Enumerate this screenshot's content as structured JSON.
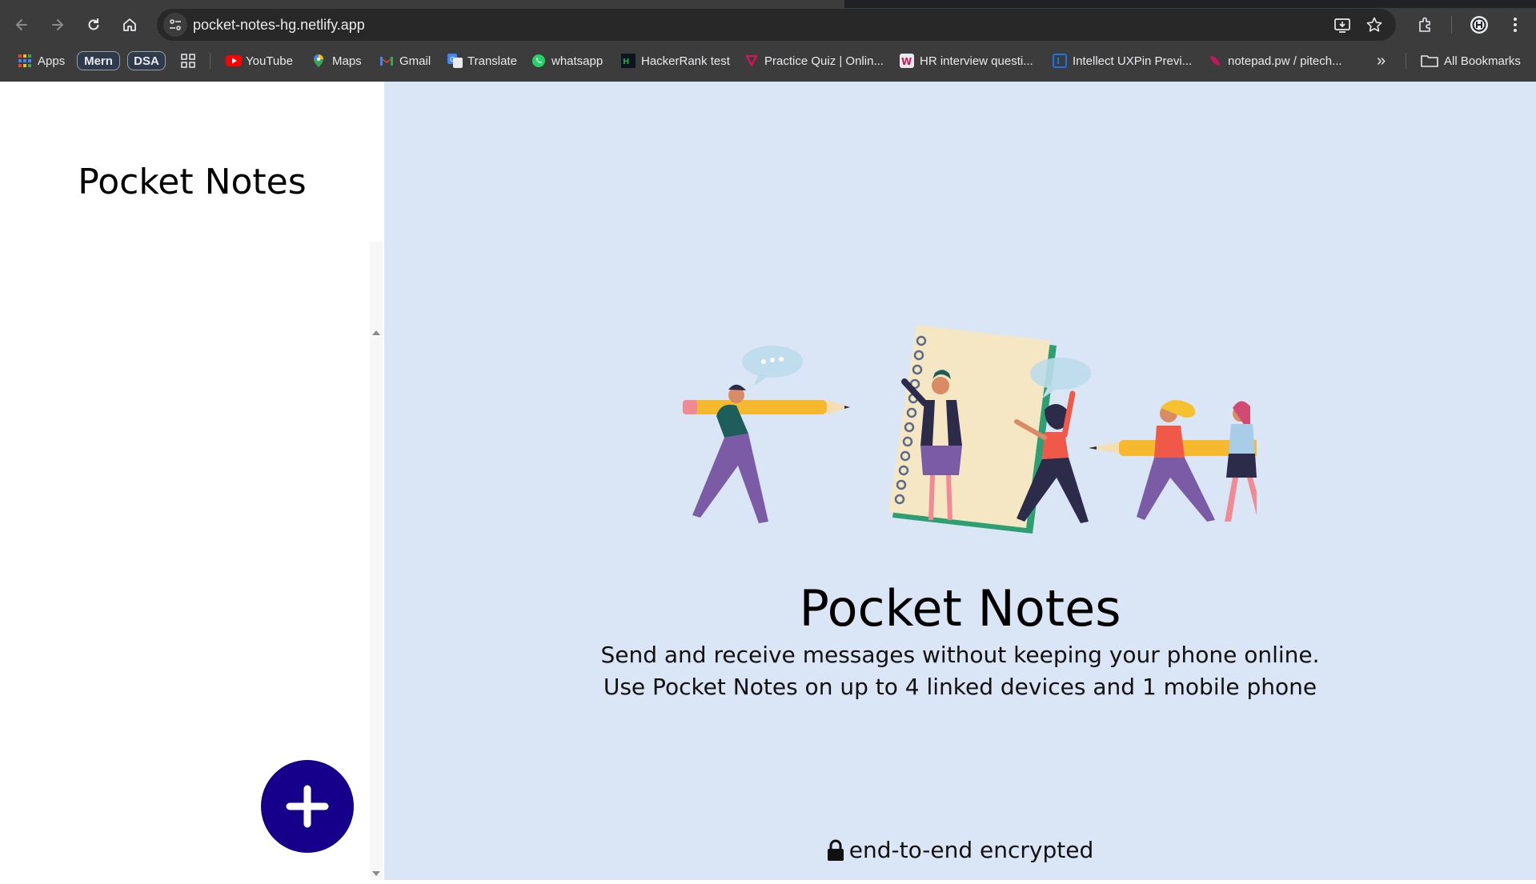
{
  "browser": {
    "url": "pocket-notes-hg.netlify.app",
    "bookmarks": [
      {
        "label": "Apps",
        "icon": "apps-grid-icon"
      },
      {
        "label": "YouTube",
        "icon": "youtube-icon"
      },
      {
        "label": "Maps",
        "icon": "maps-icon"
      },
      {
        "label": "Gmail",
        "icon": "gmail-icon"
      },
      {
        "label": "Translate",
        "icon": "translate-icon"
      },
      {
        "label": "whatsapp",
        "icon": "whatsapp-icon"
      },
      {
        "label": "HackerRank test",
        "icon": "hackerrank-icon"
      },
      {
        "label": "Practice Quiz | Onlin...",
        "icon": "quiz-icon"
      },
      {
        "label": "HR interview questi...",
        "icon": "hr-icon"
      },
      {
        "label": "Intellect UXPin Previ...",
        "icon": "uxpin-icon"
      },
      {
        "label": "notepad.pw / pitech...",
        "icon": "notepad-icon"
      }
    ],
    "bookmark_pills": [
      "Mern",
      "DSA"
    ],
    "all_bookmarks_label": "All Bookmarks",
    "overflow_label": "»"
  },
  "sidebar": {
    "title": "Pocket Notes",
    "add_button_label": "+"
  },
  "main": {
    "title": "Pocket Notes",
    "line1": "Send and receive messages without keeping your phone online.",
    "line2": "Use Pocket Notes on up to 4 linked devices and 1 mobile phone",
    "encryption_label": "end-to-end encrypted"
  },
  "colors": {
    "main_bg": "#dae5f5",
    "accent": "#16008b"
  }
}
